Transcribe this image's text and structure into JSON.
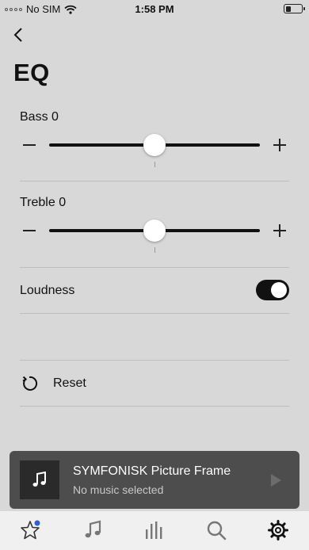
{
  "status_bar": {
    "carrier": "No SIM",
    "time": "1:58 PM",
    "wifi_icon": "wifi-icon",
    "battery_icon": "battery-icon"
  },
  "navigation": {
    "back_icon": "chevron-left-icon"
  },
  "page": {
    "title": "EQ"
  },
  "eq": {
    "bass": {
      "label": "Bass",
      "value": "0",
      "numeric_value": 0,
      "min": -10,
      "max": 10
    },
    "treble": {
      "label": "Treble",
      "value": "0",
      "numeric_value": 0,
      "min": -10,
      "max": 10
    },
    "loudness": {
      "label": "Loudness",
      "enabled": true
    },
    "reset": {
      "label": "Reset",
      "icon": "reset-icon"
    }
  },
  "now_playing": {
    "title": "SYMFONISK Picture Frame",
    "subtitle": "No music selected",
    "art_icon": "music-note-icon",
    "play_icon": "play-icon"
  },
  "tab_bar": {
    "tabs": [
      {
        "name": "favorites",
        "icon": "star-icon",
        "has_badge": true
      },
      {
        "name": "music",
        "icon": "music-note-icon"
      },
      {
        "name": "rooms",
        "icon": "bars-icon"
      },
      {
        "name": "search",
        "icon": "search-icon"
      },
      {
        "name": "settings",
        "icon": "gear-icon",
        "selected": true
      }
    ]
  },
  "colors": {
    "background": "#d8d8d8",
    "accent": "#111111",
    "now_playing_bg": "#4d4d4d",
    "tab_bar_bg": "#f0f0f0",
    "badge": "#2f5fd0"
  }
}
